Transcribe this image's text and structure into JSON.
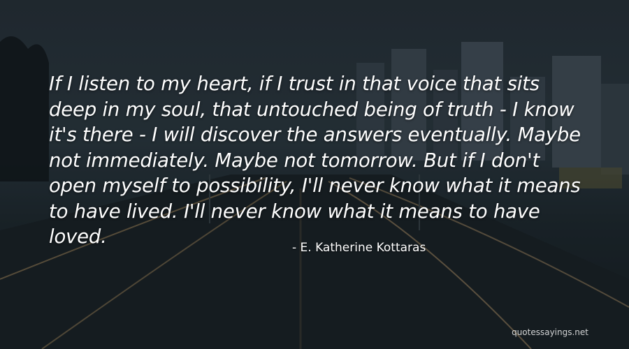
{
  "quote": {
    "lines": [
      "If I listen to my heart, if I trust in that voice that sits",
      "deep in my soul, that untouched being of truth - I know",
      "it's there - I will discover the answers eventually. Maybe",
      "not immediately. Maybe not tomorrow. But if I don't",
      "open myself to possibility, I'll never know what it means",
      "to have lived. I'll never know what it means to have",
      "loved."
    ],
    "author": "- E. Katherine Kottaras"
  },
  "watermark": "quotessayings.net",
  "colors": {
    "text": "#ffffff",
    "sky": "#2c3a42",
    "road": "#151c20",
    "light_trail": "#c9a36a"
  }
}
